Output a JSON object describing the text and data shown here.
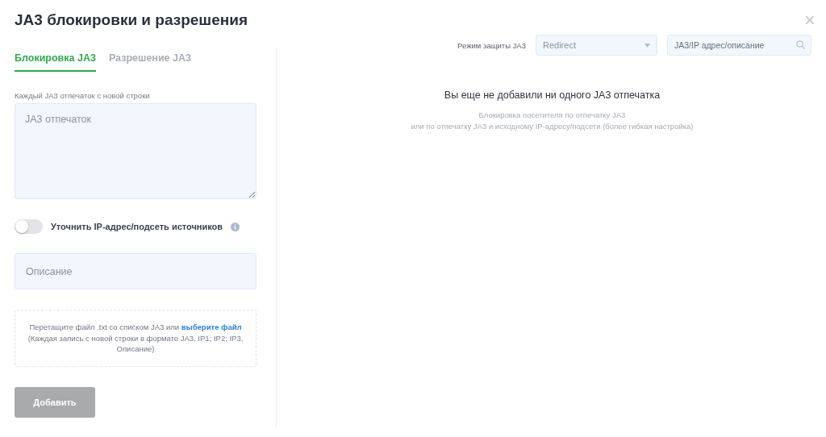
{
  "dialog": {
    "title": "JA3 блокировки и разрешения",
    "close": "×"
  },
  "tabs": [
    {
      "label": "Блокировка JA3",
      "selected": true
    },
    {
      "label": "Разрешение JA3",
      "selected": false
    }
  ],
  "fingerprints": {
    "label": "Каждый JA3 отпечаток с новой строки",
    "placeholder": "JA3 отпечаток"
  },
  "refine_toggle": {
    "label": "Уточнить IP-адрес/подсеть источников",
    "on": false
  },
  "description": {
    "placeholder": "Описание"
  },
  "dropzone": {
    "text": "Перетащите файл .txt со списком JA3 или ",
    "link": "выберите файл",
    "note": "(Каждая запись с новой строки в формате JA3, IP1; IP2; IP3, Описание)"
  },
  "add_button": {
    "label": "Добавить",
    "disabled": true
  },
  "mode": {
    "label": "Режим защиты JA3",
    "value": "Redirect"
  },
  "search": {
    "placeholder": "JA3/IP адрес/описание"
  },
  "empty_state": {
    "title": "Вы еще не добавили ни одного JA3 отпечатка",
    "lines": [
      "Блокировка посетителя по отпечатку JA3",
      "или по отпечатку JA3 и исходному IP-адресу/подсети (более гибкая настройка)"
    ]
  }
}
